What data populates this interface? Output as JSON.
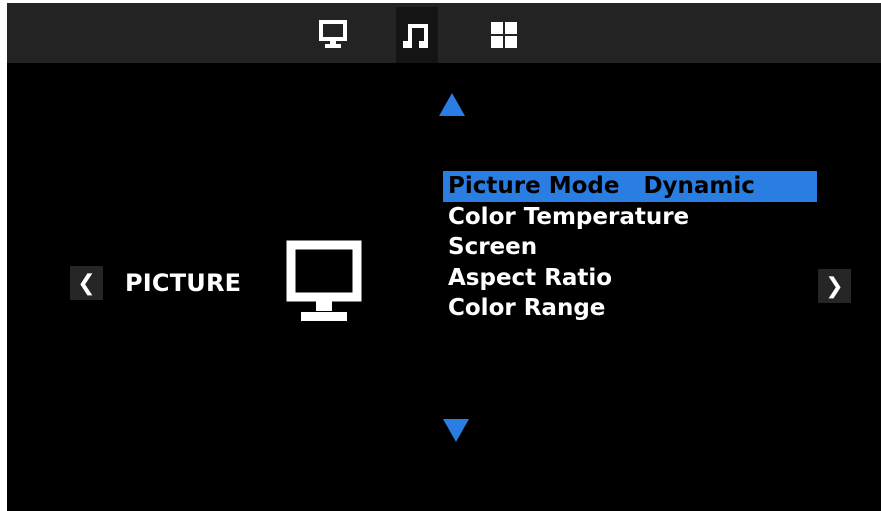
{
  "top_tabs": [
    {
      "icon": "monitor-icon",
      "active": false
    },
    {
      "icon": "music-note-icon",
      "active": true
    },
    {
      "icon": "grid-icon",
      "active": false
    }
  ],
  "section": {
    "label": "PICTURE",
    "icon": "monitor-icon",
    "prev_glyph": "❮",
    "next_glyph": "❯"
  },
  "menu": {
    "items": [
      {
        "label": "Picture Mode",
        "value": "Dynamic",
        "selected": true
      },
      {
        "label": "Color Temperature",
        "value": "",
        "selected": false
      },
      {
        "label": "Screen",
        "value": "",
        "selected": false
      },
      {
        "label": "Aspect Ratio",
        "value": "",
        "selected": false
      },
      {
        "label": "Color Range",
        "value": "",
        "selected": false
      }
    ]
  },
  "colors": {
    "accent": "#2a7de1",
    "background": "#000000",
    "topbar": "#232323"
  }
}
